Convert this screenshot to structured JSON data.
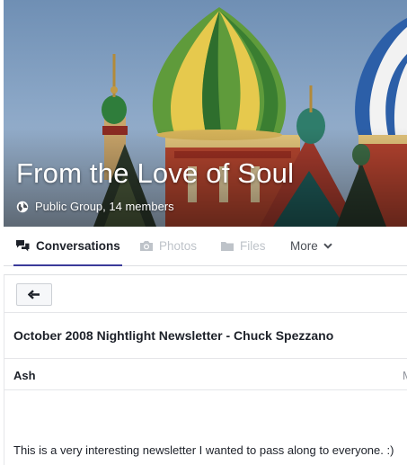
{
  "group": {
    "title": "From the Love of Soul",
    "meta": "Public Group, 14 members",
    "privacy_icon": "globe-icon"
  },
  "tabs": [
    {
      "label": "Conversations",
      "icon": "speech-bubbles-icon",
      "state": "active"
    },
    {
      "label": "Photos",
      "icon": "camera-icon",
      "state": "disabled"
    },
    {
      "label": "Files",
      "icon": "folder-icon",
      "state": "disabled"
    },
    {
      "label": "More",
      "icon": "chevron-down-icon",
      "state": "normal"
    }
  ],
  "thread": {
    "back_icon": "arrow-left-icon",
    "subject": "October 2008 Nightlight Newsletter - Chuck Spezzano",
    "author": "Ash",
    "timestamp": "M",
    "body": "This is a very interesting newsletter I wanted to pass along to everyone. :)"
  },
  "colors": {
    "active_tab_underline": "#3b3b9a",
    "disabled_tab": "#bec3c9",
    "text": "#1d2129",
    "border": "#dddfe2"
  }
}
